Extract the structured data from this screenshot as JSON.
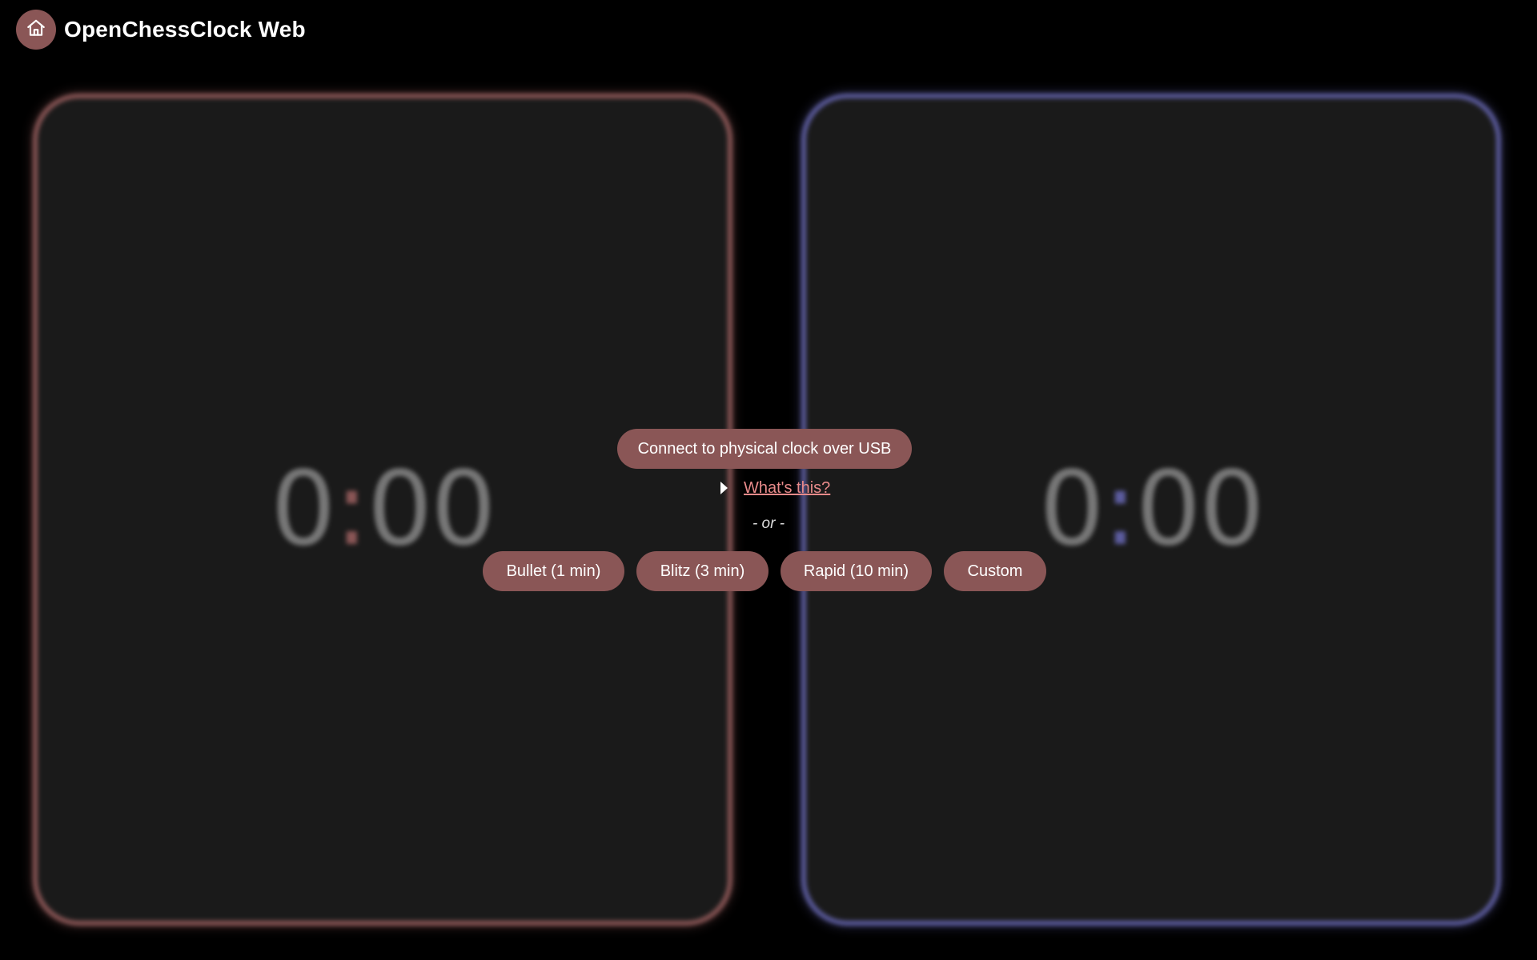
{
  "header": {
    "title": "OpenChessClock Web",
    "home_icon": "home-icon"
  },
  "clocks": {
    "left": {
      "minutes": "0",
      "seconds": "00",
      "accent": "#8a5656"
    },
    "right": {
      "minutes": "0",
      "seconds": "00",
      "accent": "#5c5c9e"
    }
  },
  "controls": {
    "connect_label": "Connect to physical clock over USB",
    "whats_this_label": "What's this?",
    "or_label": "- or -",
    "presets": [
      {
        "label": "Bullet (1 min)"
      },
      {
        "label": "Blitz (3 min)"
      },
      {
        "label": "Rapid (10 min)"
      },
      {
        "label": "Custom"
      }
    ]
  },
  "colors": {
    "background": "#000000",
    "panel": "#1a1a1a",
    "button": "#8a5656",
    "link": "#e88a8a"
  }
}
